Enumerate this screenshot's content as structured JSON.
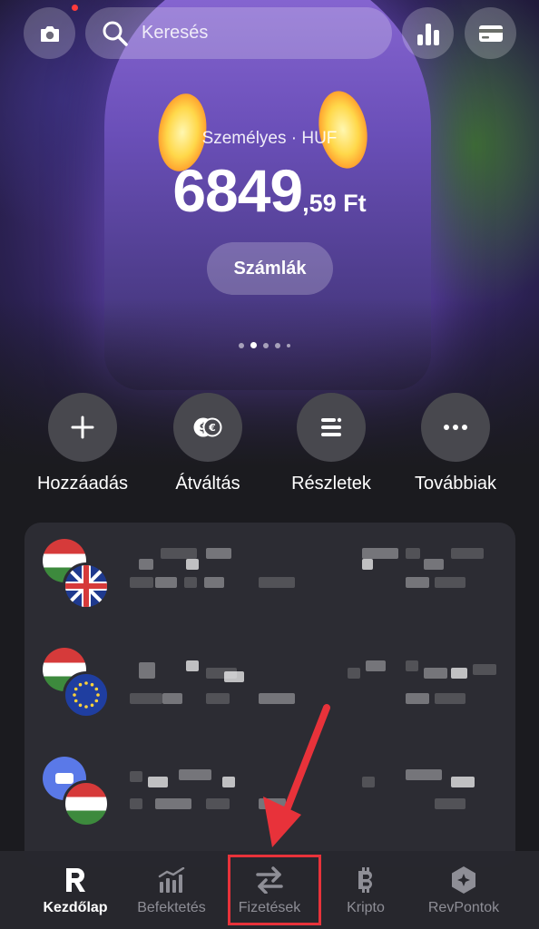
{
  "search": {
    "placeholder": "Keresés"
  },
  "account": {
    "label": "Személyes · HUF",
    "balance_integer": "6849",
    "balance_fraction": ",59 Ft",
    "accounts_button": "Számlák"
  },
  "pager": {
    "count": 5,
    "active_index": 1
  },
  "actions": [
    {
      "label": "Hozzáadás",
      "icon": "plus-icon"
    },
    {
      "label": "Átváltás",
      "icon": "exchange-icon"
    },
    {
      "label": "Részletek",
      "icon": "details-icon"
    },
    {
      "label": "Továbbiak",
      "icon": "more-icon"
    }
  ],
  "accounts_list": [
    {
      "flags": [
        "HU",
        "GB"
      ]
    },
    {
      "flags": [
        "HU",
        "EU"
      ]
    },
    {
      "flags": [
        "blue",
        "HU"
      ]
    }
  ],
  "nav": {
    "items": [
      {
        "label": "Kezdőlap",
        "icon": "revolut-logo-icon",
        "active": true
      },
      {
        "label": "Befektetés",
        "icon": "invest-chart-icon",
        "active": false
      },
      {
        "label": "Fizetések",
        "icon": "transfer-arrows-icon",
        "active": false,
        "highlighted": true
      },
      {
        "label": "Kripto",
        "icon": "bitcoin-icon",
        "active": false
      },
      {
        "label": "RevPontok",
        "icon": "revpoints-icon",
        "active": false
      }
    ]
  },
  "colors": {
    "annotation_red": "#e8323a",
    "card_bg": "#2c2c33",
    "nav_inactive": "#8e8e96"
  }
}
